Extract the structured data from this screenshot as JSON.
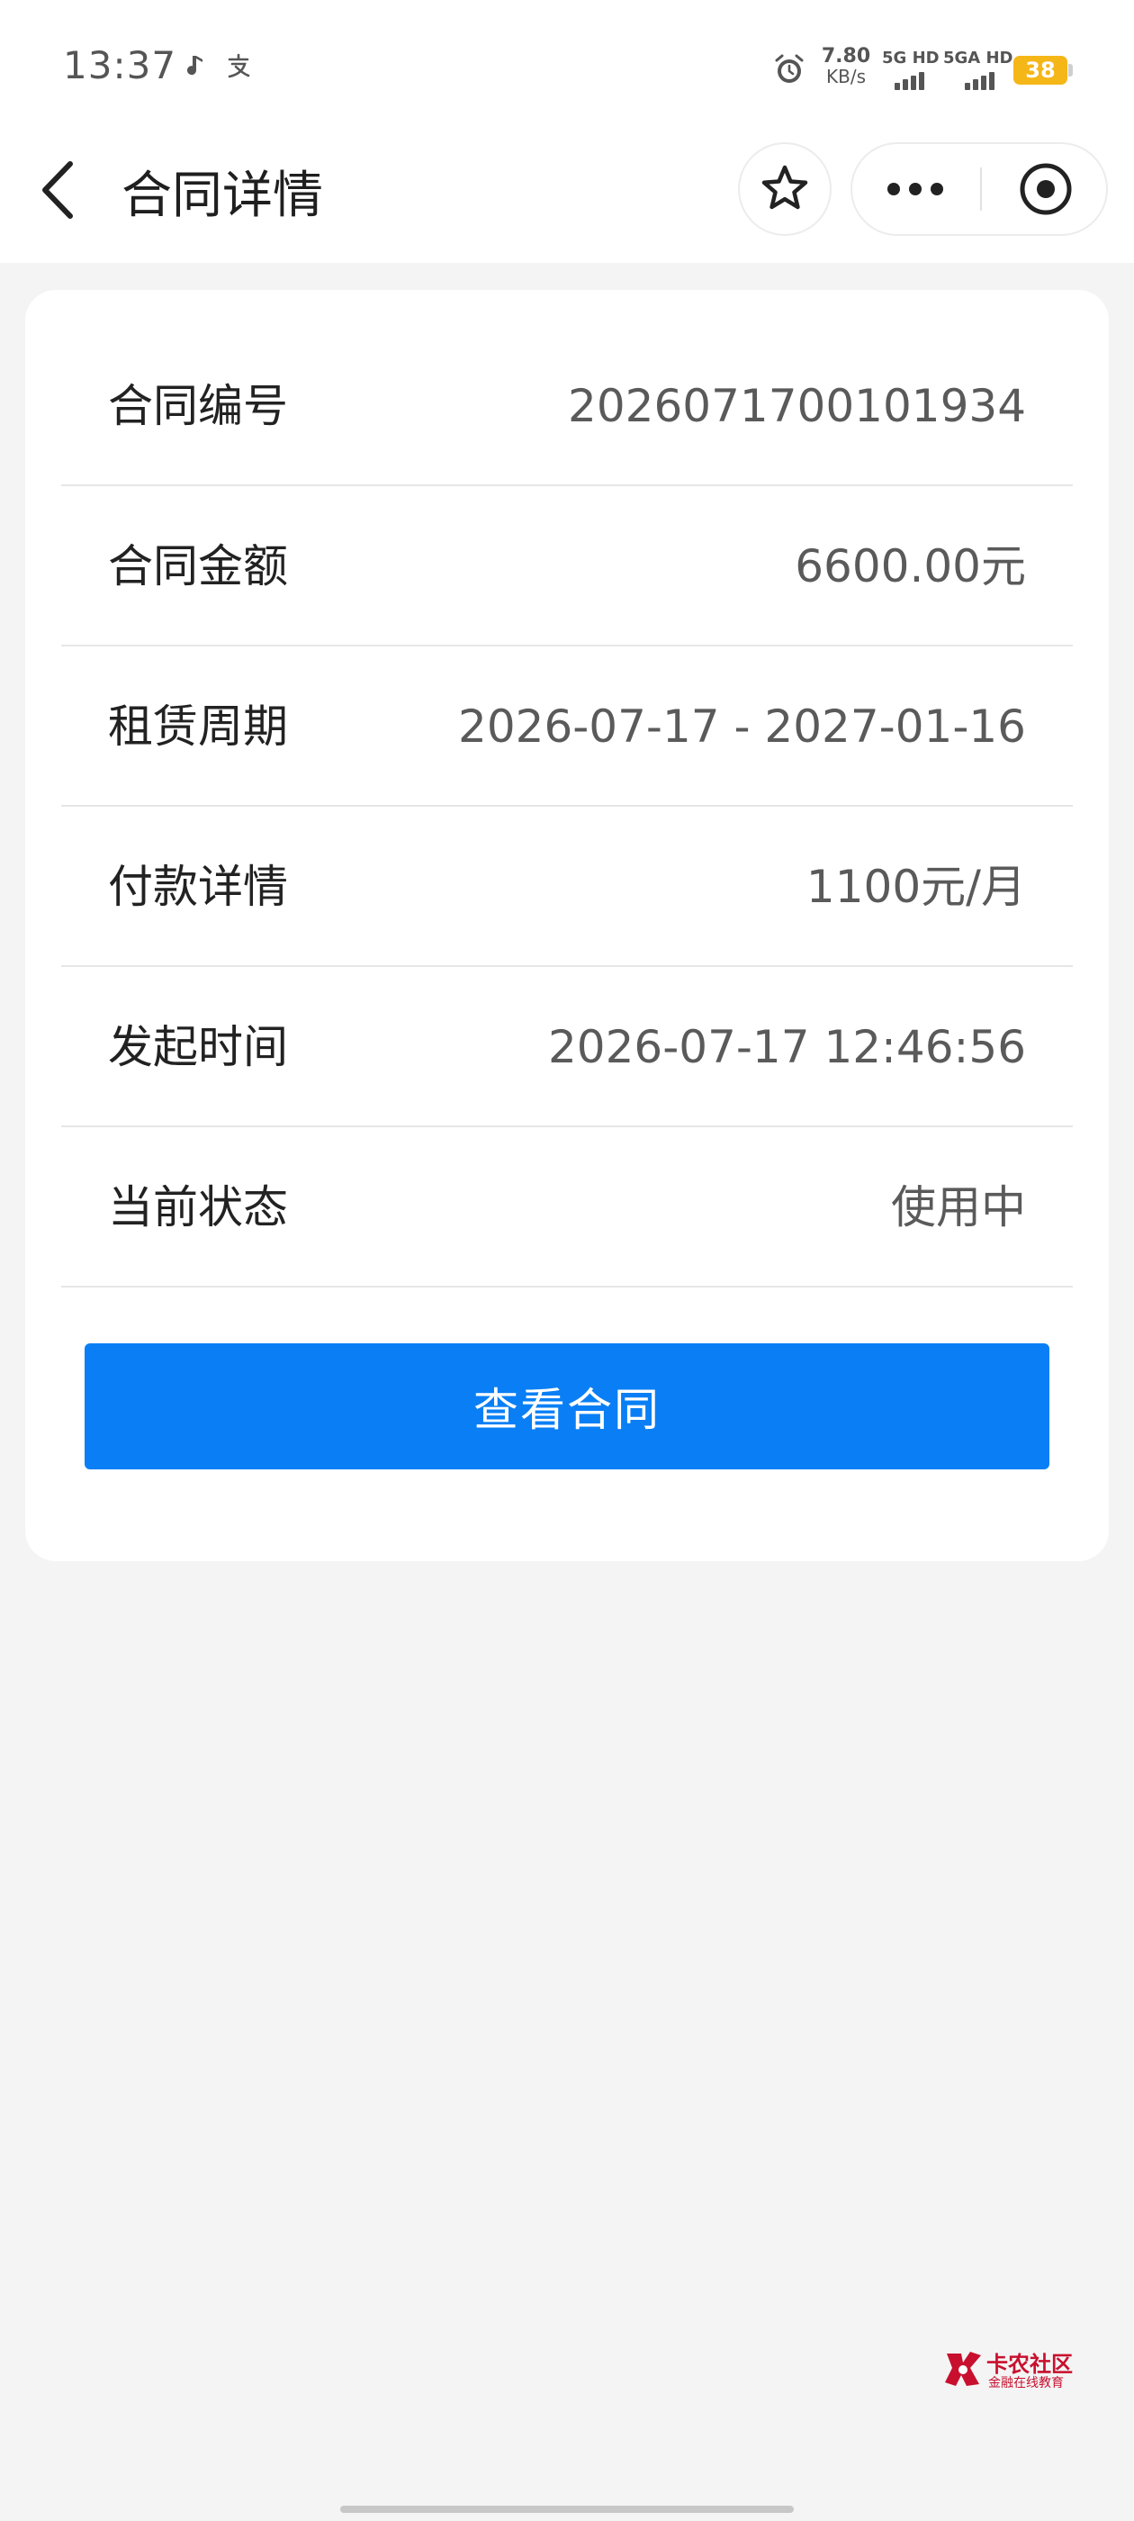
{
  "status_bar": {
    "time": "13:37",
    "speed_value": "7.80",
    "speed_unit": "KB/s",
    "sim1_label": "5G HD",
    "sim2_label": "5GA HD",
    "battery": "38",
    "icons": [
      "music-note-icon",
      "alipay-icon",
      "alarm-icon",
      "signal-icon",
      "battery-icon"
    ]
  },
  "nav": {
    "title": "合同详情",
    "icons": [
      "back-icon",
      "star-icon",
      "more-icon",
      "target-icon"
    ]
  },
  "contract": {
    "rows": [
      {
        "label": "合同编号",
        "value": "2026071700101934"
      },
      {
        "label": "合同金额",
        "value": "6600.00元"
      },
      {
        "label": "租赁周期",
        "value": "2026-07-17 - 2027-01-16"
      },
      {
        "label": "付款详情",
        "value": "1100元/月"
      },
      {
        "label": "发起时间",
        "value": "2026-07-17 12:46:56"
      },
      {
        "label": "当前状态",
        "value": "使用中"
      }
    ],
    "button_label": "查看合同"
  },
  "watermark": {
    "title": "卡农社区",
    "subtitle": "金融在线教育"
  },
  "colors": {
    "primary_button": "#0a7ff5",
    "battery": "#f5b617",
    "page_background": "#f4f4f4",
    "watermark": "#c8102e"
  }
}
